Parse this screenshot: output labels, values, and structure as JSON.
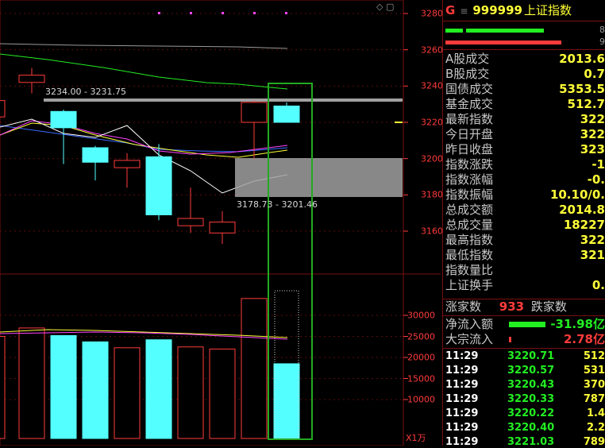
{
  "chart": {
    "price_axis": [
      "3280",
      "3260",
      "3240",
      "3220",
      "3200",
      "3180",
      "3160"
    ],
    "volume_axis": [
      "30000",
      "25000",
      "20000",
      "15000",
      "10000"
    ],
    "unit": "X1万",
    "high_range_label": "3234.00 - 3231.75",
    "low_range_label": "3178.73 - 3201.46",
    "colors": {
      "up": "#ff3b3b",
      "down": "#54ffff",
      "ma5": "#ffffff",
      "ma10": "#ffff38",
      "ma20": "#ff44ff",
      "ma30": "#3a6bff",
      "ma60": "#22ee22",
      "highlight": "#22aa22"
    }
  },
  "chart_data": {
    "type": "candlestick",
    "candles": [
      {
        "open": 3223,
        "close": 3232,
        "high": 3232,
        "low": 3190,
        "volume": 25000
      },
      {
        "open": 3242,
        "close": 3246,
        "high": 3250,
        "low": 3236,
        "volume": 27000
      },
      {
        "open": 3226,
        "close": 3217,
        "high": 3227,
        "low": 3197,
        "volume": 25200
      },
      {
        "open": 3206,
        "close": 3198,
        "high": 3207,
        "low": 3188,
        "volume": 23700
      },
      {
        "open": 3195,
        "close": 3199,
        "high": 3203,
        "low": 3184,
        "volume": 22300
      },
      {
        "open": 3201,
        "close": 3169,
        "high": 3208,
        "low": 3166,
        "volume": 24200
      },
      {
        "open": 3163,
        "close": 3167,
        "high": 3184,
        "low": 3159,
        "volume": 22500
      },
      {
        "open": 3159,
        "close": 3165,
        "high": 3171,
        "low": 3153,
        "volume": 22000
      },
      {
        "open": 3220,
        "close": 3231,
        "high": 3232,
        "low": 3200,
        "volume": 34000
      },
      {
        "open": 3229,
        "close": 3220,
        "high": 3231,
        "low": 3220,
        "volume": 18500
      }
    ]
  },
  "panel": {
    "g": "G",
    "menu": "≡",
    "code": "999999",
    "name": "上证指数",
    "bar_nums": [
      "8",
      "9"
    ],
    "rows": [
      {
        "label": "A股成交",
        "value": "2013.6"
      },
      {
        "label": "B股成交",
        "value": "0.7"
      },
      {
        "label": "国债成交",
        "value": "5353.5"
      },
      {
        "label": "基金成交",
        "value": "512.7"
      },
      {
        "label": "最新指数",
        "value": "322"
      },
      {
        "label": "今日开盘",
        "value": "322"
      },
      {
        "label": "昨日收盘",
        "value": "323"
      },
      {
        "label": "指数涨跌",
        "value": "-1"
      },
      {
        "label": "指数涨幅",
        "value": "-0."
      },
      {
        "label": "指数振幅",
        "value": "10.10/0."
      },
      {
        "label": "总成交额",
        "value": "2014.8"
      },
      {
        "label": "总成交量",
        "value": "18227"
      },
      {
        "label": "最高指数",
        "value": "322"
      },
      {
        "label": "最低指数",
        "value": "321"
      },
      {
        "label": "指数量比",
        "value": ""
      },
      {
        "label": "上证换手",
        "value": "0."
      }
    ],
    "updown": {
      "rise_label": "涨家数",
      "rise_value": "933",
      "fall_label": "跌家数"
    },
    "flows": [
      {
        "label": "净流入额",
        "value": "-31.98亿",
        "color": "#22ee22"
      },
      {
        "label": "大宗流入",
        "value": "2.78亿",
        "color": "#ff3b3b"
      }
    ],
    "ticks": [
      {
        "time": "11:29",
        "price": "3220.71",
        "vol": "512"
      },
      {
        "time": "11:29",
        "price": "3220.57",
        "vol": "531"
      },
      {
        "time": "11:29",
        "price": "3220.43",
        "vol": "370"
      },
      {
        "time": "11:29",
        "price": "3220.33",
        "vol": "787"
      },
      {
        "time": "11:29",
        "price": "3220.22",
        "vol": "1.4"
      },
      {
        "time": "11:29",
        "price": "3220.40",
        "vol": "2.2"
      },
      {
        "time": "11:29",
        "price": "3221.03",
        "vol": "789"
      }
    ]
  }
}
